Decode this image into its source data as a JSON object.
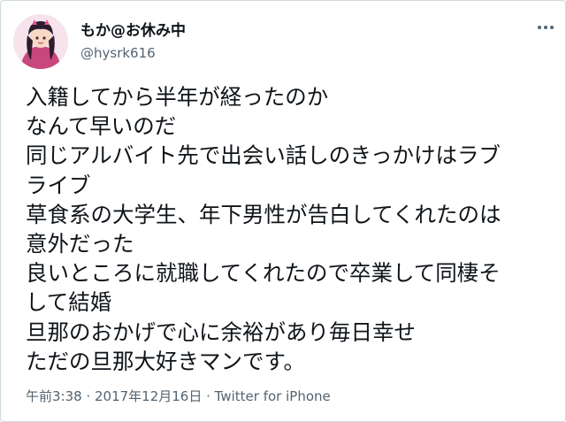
{
  "user": {
    "display_name": "もか@お休み中",
    "handle": "@hysrk616",
    "avatar_icon": "user-avatar-icon"
  },
  "menu": {
    "icon": "more-horizontal-icon"
  },
  "tweet": {
    "lines": [
      "入籍してから半年が経ったのか",
      "なんて早いのだ",
      "同じアルバイト先で出会い話しのきっかけはラブ",
      "ライブ",
      "草食系の大学生、年下男性が告白してくれたのは",
      "意外だった",
      "良いところに就職してくれたので卒業して同棲そ",
      "して結婚",
      "旦那のおかげで心に余裕があり毎日幸せ",
      "ただの旦那大好きマンです。"
    ]
  },
  "meta": {
    "time": "午前3:38",
    "separator1": " · ",
    "date": "2017年12月16日",
    "separator2": " · ",
    "source": "Twitter for iPhone"
  },
  "colors": {
    "text": "#0f1419",
    "secondary": "#536471",
    "border": "#cfd9de",
    "background": "#ffffff"
  }
}
